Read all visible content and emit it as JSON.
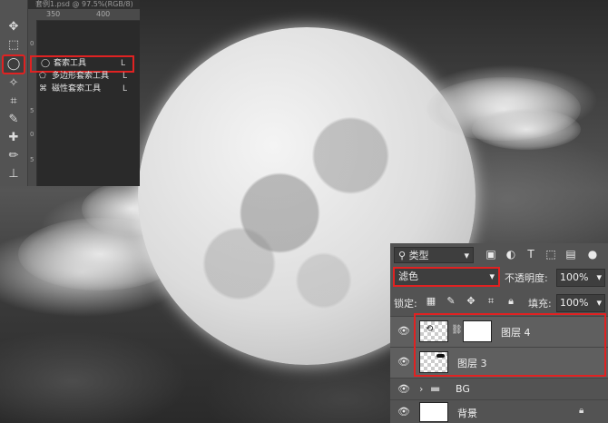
{
  "document": {
    "title": "套例1.psd @ 97.5%(RGB/8)"
  },
  "rulers": {
    "top_ticks": [
      "350",
      "400"
    ],
    "left_ticks": [
      "0",
      "5",
      "0",
      "5"
    ]
  },
  "tools": [
    {
      "name": "move-tool-icon",
      "glyph": "✥"
    },
    {
      "name": "marquee-tool-icon",
      "glyph": "⬚"
    },
    {
      "name": "lasso-tool-icon",
      "glyph": "◯",
      "selected": true
    },
    {
      "name": "magic-wand-tool-icon",
      "glyph": "✧"
    },
    {
      "name": "crop-tool-icon",
      "glyph": "⌗"
    },
    {
      "name": "eyedropper-tool-icon",
      "glyph": "✎"
    },
    {
      "name": "healing-brush-tool-icon",
      "glyph": "✚"
    },
    {
      "name": "brush-tool-icon",
      "glyph": "✏"
    },
    {
      "name": "clone-stamp-tool-icon",
      "glyph": "⊥"
    }
  ],
  "lasso_flyout": {
    "items": [
      {
        "label": "套索工具",
        "key": "L",
        "icon": "lasso-icon",
        "selected": true
      },
      {
        "label": "多边形套索工具",
        "key": "L",
        "icon": "polygonal-lasso-icon"
      },
      {
        "label": "磁性套索工具",
        "key": "L",
        "icon": "magnetic-lasso-icon"
      }
    ]
  },
  "layers_panel": {
    "filter_type": "类型",
    "blend_mode": "滤色",
    "opacity_label": "不透明度:",
    "opacity_value": "100%",
    "lock_label": "锁定:",
    "fill_label": "填充:",
    "fill_value": "100%",
    "layers": [
      {
        "name": "图层 4",
        "visible": true,
        "has_mask": true
      },
      {
        "name": "图层 3",
        "visible": true,
        "has_mask": false
      },
      {
        "name": "BG",
        "visible": true,
        "group": true
      },
      {
        "name": "背景",
        "visible": true,
        "locked": true
      }
    ]
  },
  "colors": {
    "highlight": "#e02222",
    "panel_bg": "#535353",
    "field_bg": "#3e3e3e"
  }
}
